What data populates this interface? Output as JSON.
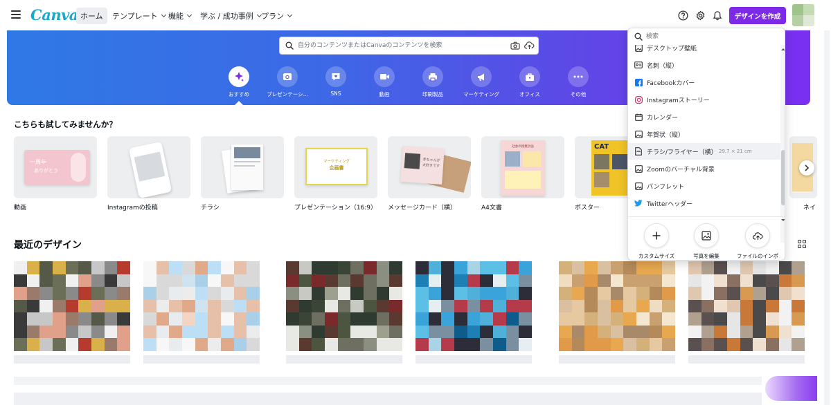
{
  "nav": {
    "logo": "Canva",
    "items": [
      "ホーム",
      "テンプレート",
      "機能",
      "学ぶ / 成功事例",
      "プラン"
    ],
    "cta_label": "デザインを作成"
  },
  "hero": {
    "search_placeholder": "自分のコンテンツまたはCanvaのコンテンツを検索",
    "categories": [
      "おすすめ",
      "プレゼンテーシ...",
      "SNS",
      "動画",
      "印刷製品",
      "マーケティング",
      "オフィス",
      "その他"
    ]
  },
  "try_section": {
    "heading": "こちらも試してみませんか？",
    "cards": [
      "動画",
      "Instagramの投稿",
      "チラシ",
      "プレゼンテーション（16:9）",
      "メッセージカード（横）",
      "A4文書",
      "ポスター"
    ],
    "overflow_label": "ネイ",
    "card_texts": {
      "video_line1": "一周年",
      "video_line2": "ありがとう",
      "presentation_line1": "マーケティング",
      "presentation_line2": "企画書",
      "message_line1": "赤ちゃんが",
      "message_line2": "大好きです",
      "a4_title": "社会の授業計画",
      "poster_word": "CAT"
    }
  },
  "recent": {
    "heading": "最近のデザイン"
  },
  "dropdown": {
    "search_placeholder": "検索",
    "items": [
      {
        "label": "デスクトップ壁紙",
        "icon": "image-icon"
      },
      {
        "label": "名刺（縦）",
        "icon": "card-icon"
      },
      {
        "label": "Facebookカバー",
        "icon": "facebook-icon"
      },
      {
        "label": "Instagramストーリー",
        "icon": "instagram-icon"
      },
      {
        "label": "カレンダー",
        "icon": "calendar-icon"
      },
      {
        "label": "年賀状（縦）",
        "icon": "image-icon"
      },
      {
        "label": "チラシ/フライヤー（横）",
        "icon": "document-icon",
        "size": "29.7 × 21 cm"
      },
      {
        "label": "Zoomのバーチャル背景",
        "icon": "image-icon"
      },
      {
        "label": "パンフレット",
        "icon": "image-icon"
      },
      {
        "label": "Twitterヘッダー",
        "icon": "twitter-icon"
      }
    ],
    "actions": [
      "カスタムサイズ",
      "写真を編集",
      "ファイルのインポ"
    ]
  },
  "colors": {
    "brand_purple": "#7d2ae8",
    "hero_start": "#2f79e5",
    "hero_end": "#7b2ff0",
    "logo": "#1aa9c9",
    "facebook": "#1877f2",
    "twitter": "#1d9bf0",
    "instagram": "#e1306c"
  }
}
